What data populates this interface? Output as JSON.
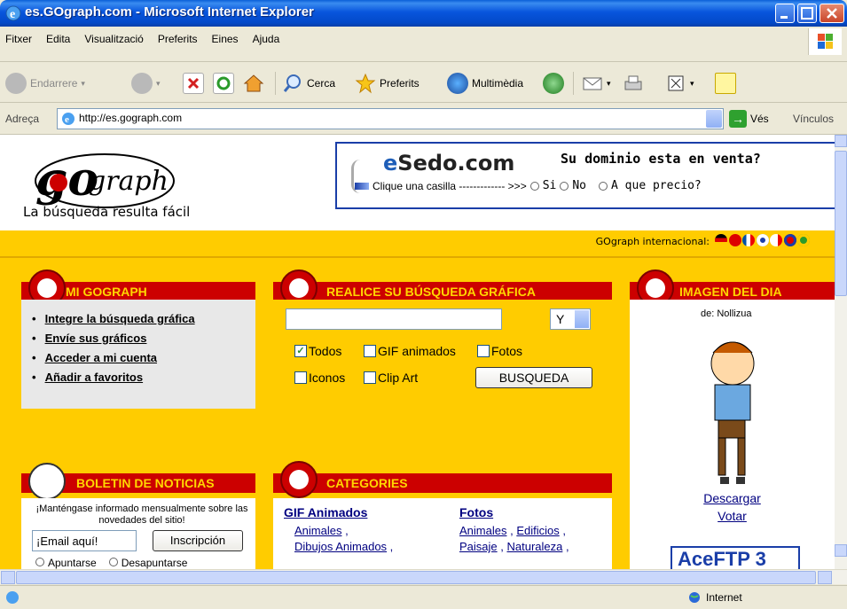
{
  "window": {
    "title": "es.GOgraph.com - Microsoft Internet Explorer"
  },
  "menu": [
    "Fitxer",
    "Edita",
    "Visualització",
    "Preferits",
    "Eines",
    "Ajuda"
  ],
  "toolbar": {
    "back": "Endarrere",
    "search": "Cerca",
    "favorites": "Preferits",
    "media": "Multimèdia"
  },
  "address": {
    "label": "Adreça",
    "url": "http://es.gograph.com",
    "go": "Vés",
    "links": "Vínculos"
  },
  "site": {
    "logo_text": "go",
    "logo_word": "graph",
    "slogan": "La búsqueda resulta fácil",
    "intl_label": "GOgraph internacional:"
  },
  "ad": {
    "brand_prefix": "e",
    "brand_main": "Sedo",
    "brand_suffix": ".com",
    "question": "Su dominio esta en venta?",
    "instruction": "Clique una casilla ------------- >>>",
    "opt_si": "Si",
    "opt_no": "No",
    "opt_price": "A que precio?"
  },
  "mi_gograph": {
    "title": "MI GOGRAPH",
    "links": [
      "Integre la búsqueda gráfica",
      "Envíe sus gráficos",
      "Acceder a mi cuenta",
      "Añadir a favoritos"
    ]
  },
  "search": {
    "title": "REALICE SU BÚSQUEDA GRÁFICA",
    "input_value": "",
    "select_value": "Y",
    "checkboxes": [
      {
        "label": "Todos",
        "checked": true
      },
      {
        "label": "GIF animados",
        "checked": false
      },
      {
        "label": "Fotos",
        "checked": false
      },
      {
        "label": "Iconos",
        "checked": false
      },
      {
        "label": "Clip Art",
        "checked": false
      }
    ],
    "button": "BUSQUEDA"
  },
  "imagen_del_dia": {
    "title": "IMAGEN DEL DIA",
    "author": "de: Nollizua",
    "download": "Descargar",
    "vote": "Votar",
    "banner": "AceFTP 3"
  },
  "boletin": {
    "title": "BOLETIN DE NOTICIAS",
    "text": "¡Manténgase informado mensualmente sobre las novedades del sitio!",
    "email_value": "¡Email aquí!",
    "button": "Inscripción",
    "radio1": "Apuntarse",
    "radio2": "Desapuntarse"
  },
  "categories": {
    "title": "CATEGORIES",
    "col1": {
      "heading": "GIF Animados",
      "items": [
        "Animales",
        "Dibujos Animados"
      ]
    },
    "col2": {
      "heading": "Fotos",
      "items": [
        "Animales",
        "Edificios",
        "Paisaje",
        "Naturaleza"
      ]
    }
  },
  "status": {
    "zone": "Internet"
  },
  "colors": {
    "page_bg": "#ffcc00",
    "section_title_bg": "#cc0000",
    "section_title_fg": "#ffd700",
    "link": "#000080"
  }
}
